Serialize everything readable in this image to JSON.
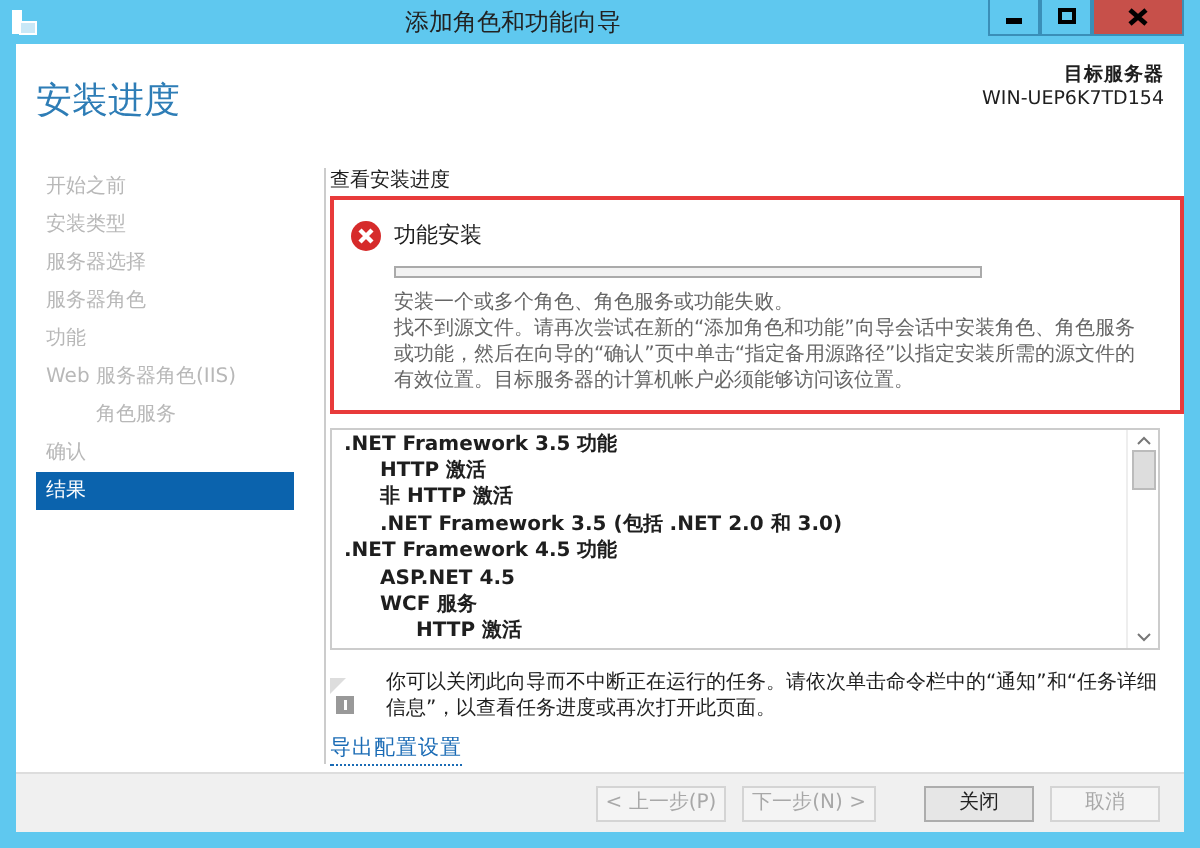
{
  "window": {
    "title": "添加角色和功能向导"
  },
  "page_title": "安装进度",
  "target_server": {
    "label": "目标服务器",
    "name": "WIN-UEP6K7TD154"
  },
  "steps": [
    {
      "label": "开始之前",
      "selected": false
    },
    {
      "label": "安装类型",
      "selected": false
    },
    {
      "label": "服务器选择",
      "selected": false
    },
    {
      "label": "服务器角色",
      "selected": false
    },
    {
      "label": "功能",
      "selected": false
    },
    {
      "label": "Web 服务器角色(IIS)",
      "selected": false,
      "children": [
        {
          "label": "角色服务",
          "selected": false
        }
      ]
    },
    {
      "label": "确认",
      "selected": false
    },
    {
      "label": "结果",
      "selected": true
    }
  ],
  "section_title": "查看安装进度",
  "status": {
    "title": "功能安装",
    "kind": "error",
    "summary": "安装一个或多个角色、角色服务或功能失败。",
    "detail": "找不到源文件。请再次尝试在新的“添加角色和功能”向导会话中安装角色、角色服务或功能，然后在向导的“确认”页中单击“指定备用源路径”以指定安装所需的源文件的有效位置。目标服务器的计算机帐户必须能够访问该位置。"
  },
  "features": [
    {
      "label": ".NET Framework 3.5 功能",
      "children": [
        {
          "label": "HTTP 激活"
        },
        {
          "label": "非 HTTP 激活"
        },
        {
          "label": ".NET Framework 3.5 (包括 .NET 2.0 和 3.0)"
        }
      ]
    },
    {
      "label": ".NET Framework 4.5 功能",
      "children": [
        {
          "label": "ASP.NET 4.5"
        },
        {
          "label": "WCF 服务",
          "children": [
            {
              "label": "HTTP 激活"
            }
          ]
        }
      ]
    }
  ],
  "note": "你可以关闭此向导而不中断正在运行的任务。请依次单击命令栏中的“通知”和“任务详细信息”，以查看任务进度或再次打开此页面。",
  "export_link": "导出配置设置",
  "buttons": [
    {
      "label": "< 上一步(P)",
      "disabled": true
    },
    {
      "label": "下一步(N) >",
      "disabled": true
    },
    {
      "label": "关闭",
      "disabled": false
    },
    {
      "label": "取消",
      "disabled": true
    }
  ]
}
